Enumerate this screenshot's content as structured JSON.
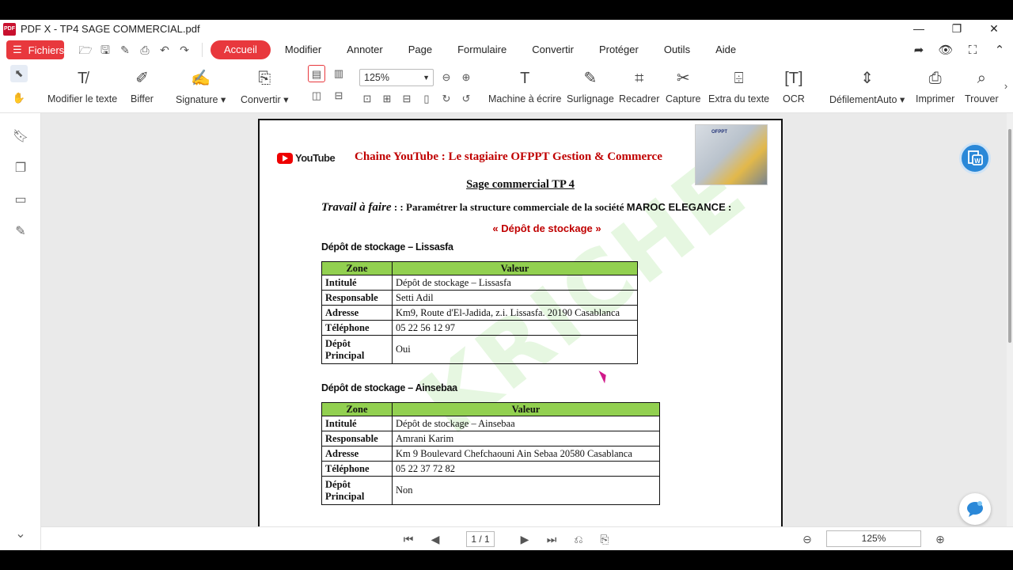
{
  "window": {
    "title": "PDF X - TP4 SAGE COMMERCIAL.pdf"
  },
  "menu": {
    "fichiers": "Fichiers",
    "tabs": [
      "Accueil",
      "Modifier",
      "Annoter",
      "Page",
      "Formulaire",
      "Convertir",
      "Protéger",
      "Outils",
      "Aide"
    ]
  },
  "toolbar": {
    "tools": [
      "Modifier le texte",
      "Biffer",
      "Signature",
      "Convertir",
      "Machine à écrire",
      "Surlignage",
      "Recadrer",
      "Capture",
      "Extra du texte",
      "OCR",
      "DéfilementAuto",
      "Imprimer",
      "Trouver"
    ],
    "zoom": "125%"
  },
  "document": {
    "youtube_label": "YouTube",
    "channel": "Chaine YouTube : Le stagiaire OFPPT Gestion & Commerce",
    "logo_text": "OFPPT",
    "title": "Sage commercial TP 4",
    "travail_script": "Travail à faire",
    "travail_text": " : : Paramétrer la structure commerciale de la société ",
    "company": "MAROC ELEGANCE",
    "colon": " :",
    "section_title": "« Dépôt de stockage »",
    "watermark": "KRICHE",
    "depots": [
      {
        "heading": "Dépôt de stockage – Lissasfa",
        "header": [
          "Zone",
          "Valeur"
        ],
        "rows": [
          [
            "Intitulé",
            "Dépôt de stockage – Lissasfa"
          ],
          [
            "Responsable",
            "Setti Adil"
          ],
          [
            "Adresse",
            "Km9, Route d'El-Jadida, z.i. Lissasfa. 20190 Casablanca"
          ],
          [
            "Téléphone",
            "05 22 56 12 97"
          ],
          [
            "Dépôt Principal",
            "Oui"
          ]
        ]
      },
      {
        "heading": "Dépôt de stockage – Ainsebaa",
        "header": [
          "Zone",
          "Valeur"
        ],
        "rows": [
          [
            "Intitulé",
            "Dépôt de stockage – Ainsebaa"
          ],
          [
            "Responsable",
            "Amrani Karim"
          ],
          [
            "Adresse",
            "Km 9 Boulevard Chefchaouni Ain Sebaa 20580 Casablanca"
          ],
          [
            "Téléphone",
            "05 22 37 72 82"
          ],
          [
            "Dépôt Principal",
            "Non"
          ]
        ]
      }
    ]
  },
  "bottom": {
    "page": "1 / 1",
    "zoom": "125%"
  },
  "colors": {
    "accent": "#e8383d",
    "table_header": "#92d050",
    "heading_red": "#c00000"
  }
}
